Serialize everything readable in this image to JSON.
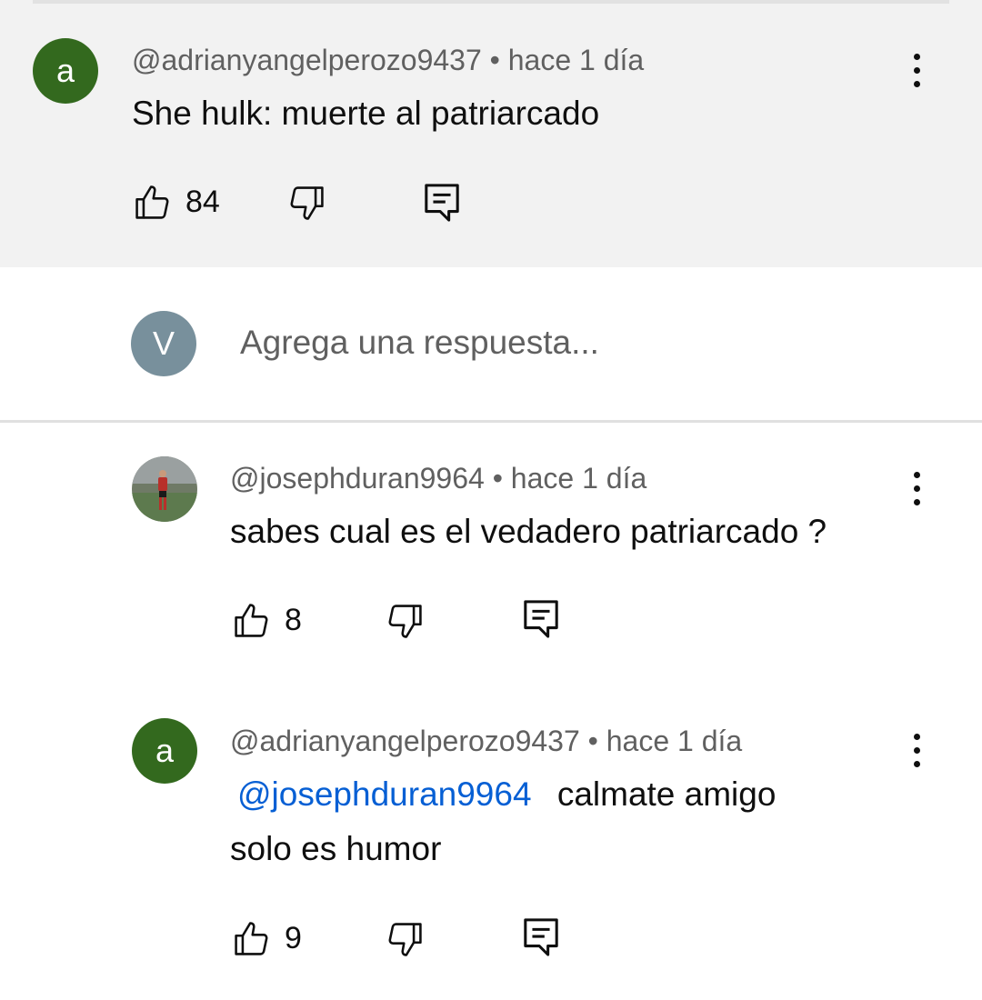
{
  "parent": {
    "avatar_letter": "a",
    "meta": "@adrianyangelperozo9437 • hace 1 día",
    "text": "She hulk: muerte al patriarcado",
    "likes": "84"
  },
  "reply_box": {
    "avatar_letter": "V",
    "placeholder": "Agrega una respuesta..."
  },
  "replies": [
    {
      "meta": "@josephduran9964 • hace 1 día",
      "text": "sabes cual es el vedadero patriarcado ?",
      "likes": "8"
    },
    {
      "avatar_letter": "a",
      "meta": "@adrianyangelperozo9437 • hace 1 día",
      "mention": "@josephduran9964",
      "text_line1": "calmate amigo",
      "text_line2": "solo es humor",
      "likes": "9"
    }
  ],
  "colors": {
    "avatar_green": "#33691e",
    "avatar_gray": "#78909c",
    "mention_blue": "#065fd4"
  },
  "icons": [
    "thumb-up-icon",
    "thumb-down-icon",
    "reply-comment-icon",
    "more-vert-icon"
  ]
}
